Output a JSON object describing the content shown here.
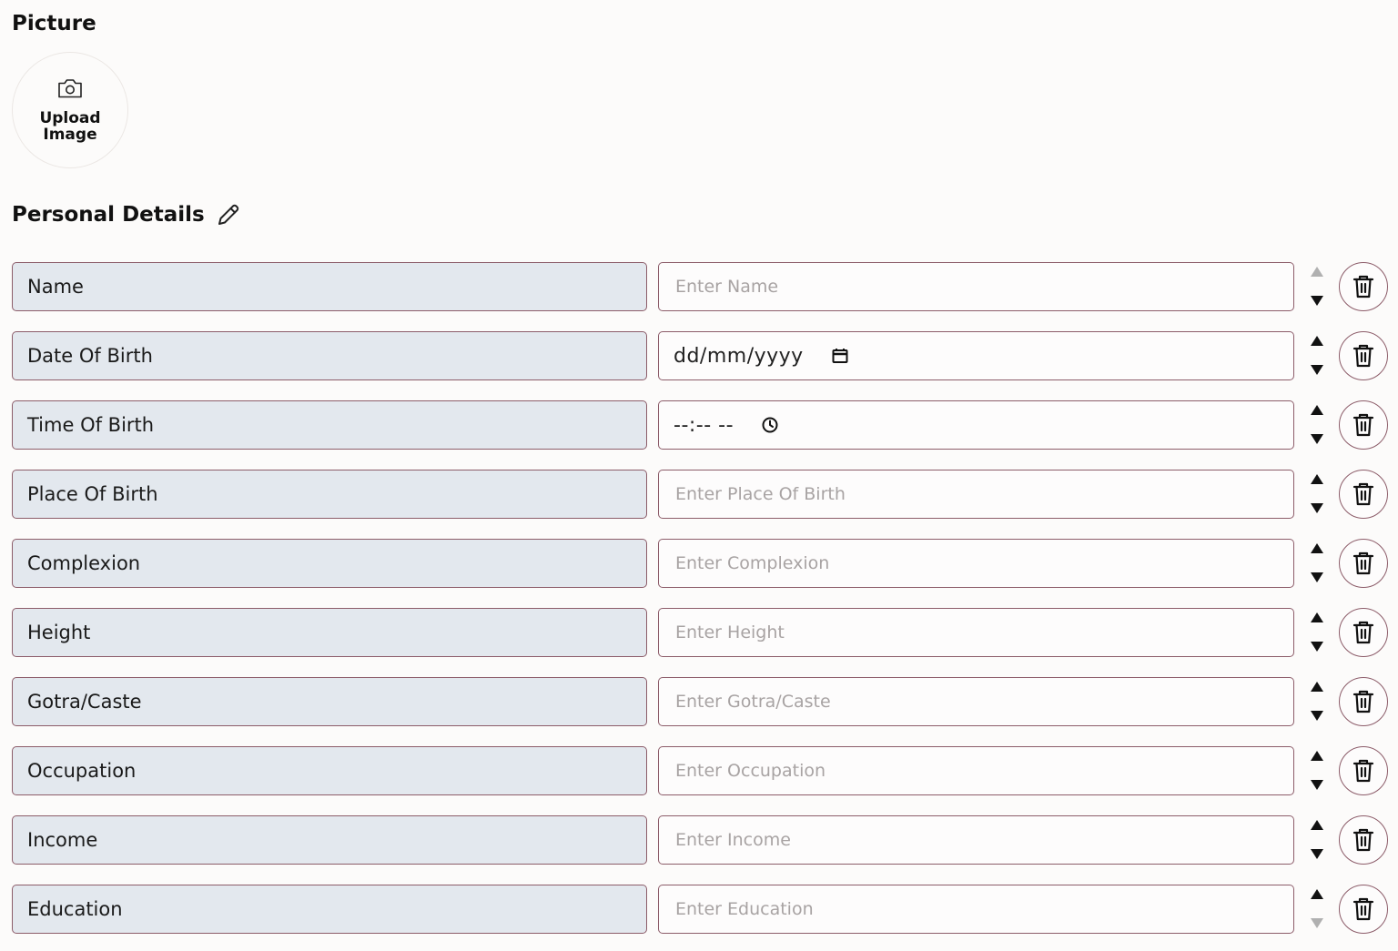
{
  "picture": {
    "title": "Picture",
    "upload_label": "Upload Image",
    "icon": "camera-icon"
  },
  "details": {
    "title": "Personal Details",
    "edit_icon": "pencil-icon",
    "rows": [
      {
        "label": "Name",
        "kind": "text",
        "placeholder": "Enter Name",
        "up_enabled": false,
        "down_enabled": true
      },
      {
        "label": "Date Of Birth",
        "kind": "date",
        "format": "dd/mm/yyyy",
        "up_enabled": true,
        "down_enabled": true
      },
      {
        "label": "Time Of Birth",
        "kind": "time",
        "format": "--:-- --",
        "up_enabled": true,
        "down_enabled": true
      },
      {
        "label": "Place Of Birth",
        "kind": "text",
        "placeholder": "Enter Place Of Birth",
        "up_enabled": true,
        "down_enabled": true
      },
      {
        "label": "Complexion",
        "kind": "text",
        "placeholder": "Enter Complexion",
        "up_enabled": true,
        "down_enabled": true
      },
      {
        "label": "Height",
        "kind": "text",
        "placeholder": "Enter Height",
        "up_enabled": true,
        "down_enabled": true
      },
      {
        "label": "Gotra/Caste",
        "kind": "text",
        "placeholder": "Enter Gotra/Caste",
        "up_enabled": true,
        "down_enabled": true
      },
      {
        "label": "Occupation",
        "kind": "text",
        "placeholder": "Enter Occupation",
        "up_enabled": true,
        "down_enabled": true
      },
      {
        "label": "Income",
        "kind": "text",
        "placeholder": "Enter Income",
        "up_enabled": true,
        "down_enabled": true
      },
      {
        "label": "Education",
        "kind": "text",
        "placeholder": "Enter Education",
        "up_enabled": true,
        "down_enabled": false
      }
    ]
  },
  "colors": {
    "background": "#fcfbfa",
    "label_fill": "#e3e8ee",
    "border": "#8c5c69",
    "placeholder": "#a8a3a3",
    "arrow_disabled": "#b0b0b0"
  }
}
